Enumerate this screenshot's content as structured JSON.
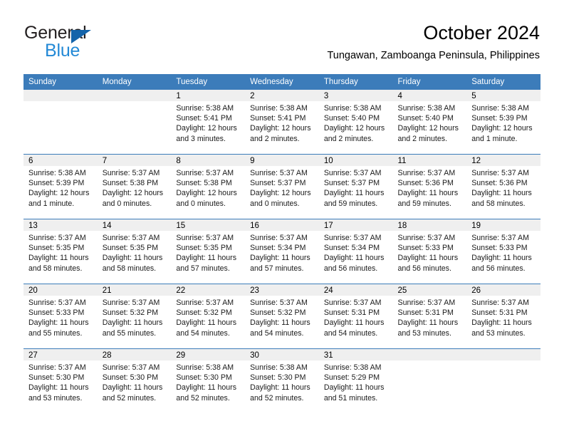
{
  "brand": {
    "name_part1": "General",
    "name_part2": "Blue"
  },
  "header": {
    "title": "October 2024",
    "subtitle": "Tungawan, Zamboanga Peninsula, Philippines"
  },
  "colors": {
    "header_blue": "#3c7cba",
    "brand_dark_blue": "#1464aa",
    "brand_light_blue": "#2389d6",
    "day_band_gray": "#efefef"
  },
  "weekday_headers": [
    "Sunday",
    "Monday",
    "Tuesday",
    "Wednesday",
    "Thursday",
    "Friday",
    "Saturday"
  ],
  "weeks": [
    [
      {
        "day": "",
        "lines": []
      },
      {
        "day": "",
        "lines": []
      },
      {
        "day": "1",
        "lines": [
          "Sunrise: 5:38 AM",
          "Sunset: 5:41 PM",
          "Daylight: 12 hours",
          "and 3 minutes."
        ]
      },
      {
        "day": "2",
        "lines": [
          "Sunrise: 5:38 AM",
          "Sunset: 5:41 PM",
          "Daylight: 12 hours",
          "and 2 minutes."
        ]
      },
      {
        "day": "3",
        "lines": [
          "Sunrise: 5:38 AM",
          "Sunset: 5:40 PM",
          "Daylight: 12 hours",
          "and 2 minutes."
        ]
      },
      {
        "day": "4",
        "lines": [
          "Sunrise: 5:38 AM",
          "Sunset: 5:40 PM",
          "Daylight: 12 hours",
          "and 2 minutes."
        ]
      },
      {
        "day": "5",
        "lines": [
          "Sunrise: 5:38 AM",
          "Sunset: 5:39 PM",
          "Daylight: 12 hours",
          "and 1 minute."
        ]
      }
    ],
    [
      {
        "day": "6",
        "lines": [
          "Sunrise: 5:38 AM",
          "Sunset: 5:39 PM",
          "Daylight: 12 hours",
          "and 1 minute."
        ]
      },
      {
        "day": "7",
        "lines": [
          "Sunrise: 5:37 AM",
          "Sunset: 5:38 PM",
          "Daylight: 12 hours",
          "and 0 minutes."
        ]
      },
      {
        "day": "8",
        "lines": [
          "Sunrise: 5:37 AM",
          "Sunset: 5:38 PM",
          "Daylight: 12 hours",
          "and 0 minutes."
        ]
      },
      {
        "day": "9",
        "lines": [
          "Sunrise: 5:37 AM",
          "Sunset: 5:37 PM",
          "Daylight: 12 hours",
          "and 0 minutes."
        ]
      },
      {
        "day": "10",
        "lines": [
          "Sunrise: 5:37 AM",
          "Sunset: 5:37 PM",
          "Daylight: 11 hours",
          "and 59 minutes."
        ]
      },
      {
        "day": "11",
        "lines": [
          "Sunrise: 5:37 AM",
          "Sunset: 5:36 PM",
          "Daylight: 11 hours",
          "and 59 minutes."
        ]
      },
      {
        "day": "12",
        "lines": [
          "Sunrise: 5:37 AM",
          "Sunset: 5:36 PM",
          "Daylight: 11 hours",
          "and 58 minutes."
        ]
      }
    ],
    [
      {
        "day": "13",
        "lines": [
          "Sunrise: 5:37 AM",
          "Sunset: 5:35 PM",
          "Daylight: 11 hours",
          "and 58 minutes."
        ]
      },
      {
        "day": "14",
        "lines": [
          "Sunrise: 5:37 AM",
          "Sunset: 5:35 PM",
          "Daylight: 11 hours",
          "and 58 minutes."
        ]
      },
      {
        "day": "15",
        "lines": [
          "Sunrise: 5:37 AM",
          "Sunset: 5:35 PM",
          "Daylight: 11 hours",
          "and 57 minutes."
        ]
      },
      {
        "day": "16",
        "lines": [
          "Sunrise: 5:37 AM",
          "Sunset: 5:34 PM",
          "Daylight: 11 hours",
          "and 57 minutes."
        ]
      },
      {
        "day": "17",
        "lines": [
          "Sunrise: 5:37 AM",
          "Sunset: 5:34 PM",
          "Daylight: 11 hours",
          "and 56 minutes."
        ]
      },
      {
        "day": "18",
        "lines": [
          "Sunrise: 5:37 AM",
          "Sunset: 5:33 PM",
          "Daylight: 11 hours",
          "and 56 minutes."
        ]
      },
      {
        "day": "19",
        "lines": [
          "Sunrise: 5:37 AM",
          "Sunset: 5:33 PM",
          "Daylight: 11 hours",
          "and 56 minutes."
        ]
      }
    ],
    [
      {
        "day": "20",
        "lines": [
          "Sunrise: 5:37 AM",
          "Sunset: 5:33 PM",
          "Daylight: 11 hours",
          "and 55 minutes."
        ]
      },
      {
        "day": "21",
        "lines": [
          "Sunrise: 5:37 AM",
          "Sunset: 5:32 PM",
          "Daylight: 11 hours",
          "and 55 minutes."
        ]
      },
      {
        "day": "22",
        "lines": [
          "Sunrise: 5:37 AM",
          "Sunset: 5:32 PM",
          "Daylight: 11 hours",
          "and 54 minutes."
        ]
      },
      {
        "day": "23",
        "lines": [
          "Sunrise: 5:37 AM",
          "Sunset: 5:32 PM",
          "Daylight: 11 hours",
          "and 54 minutes."
        ]
      },
      {
        "day": "24",
        "lines": [
          "Sunrise: 5:37 AM",
          "Sunset: 5:31 PM",
          "Daylight: 11 hours",
          "and 54 minutes."
        ]
      },
      {
        "day": "25",
        "lines": [
          "Sunrise: 5:37 AM",
          "Sunset: 5:31 PM",
          "Daylight: 11 hours",
          "and 53 minutes."
        ]
      },
      {
        "day": "26",
        "lines": [
          "Sunrise: 5:37 AM",
          "Sunset: 5:31 PM",
          "Daylight: 11 hours",
          "and 53 minutes."
        ]
      }
    ],
    [
      {
        "day": "27",
        "lines": [
          "Sunrise: 5:37 AM",
          "Sunset: 5:30 PM",
          "Daylight: 11 hours",
          "and 53 minutes."
        ]
      },
      {
        "day": "28",
        "lines": [
          "Sunrise: 5:37 AM",
          "Sunset: 5:30 PM",
          "Daylight: 11 hours",
          "and 52 minutes."
        ]
      },
      {
        "day": "29",
        "lines": [
          "Sunrise: 5:38 AM",
          "Sunset: 5:30 PM",
          "Daylight: 11 hours",
          "and 52 minutes."
        ]
      },
      {
        "day": "30",
        "lines": [
          "Sunrise: 5:38 AM",
          "Sunset: 5:30 PM",
          "Daylight: 11 hours",
          "and 52 minutes."
        ]
      },
      {
        "day": "31",
        "lines": [
          "Sunrise: 5:38 AM",
          "Sunset: 5:29 PM",
          "Daylight: 11 hours",
          "and 51 minutes."
        ]
      },
      {
        "day": "",
        "lines": []
      },
      {
        "day": "",
        "lines": []
      }
    ]
  ]
}
